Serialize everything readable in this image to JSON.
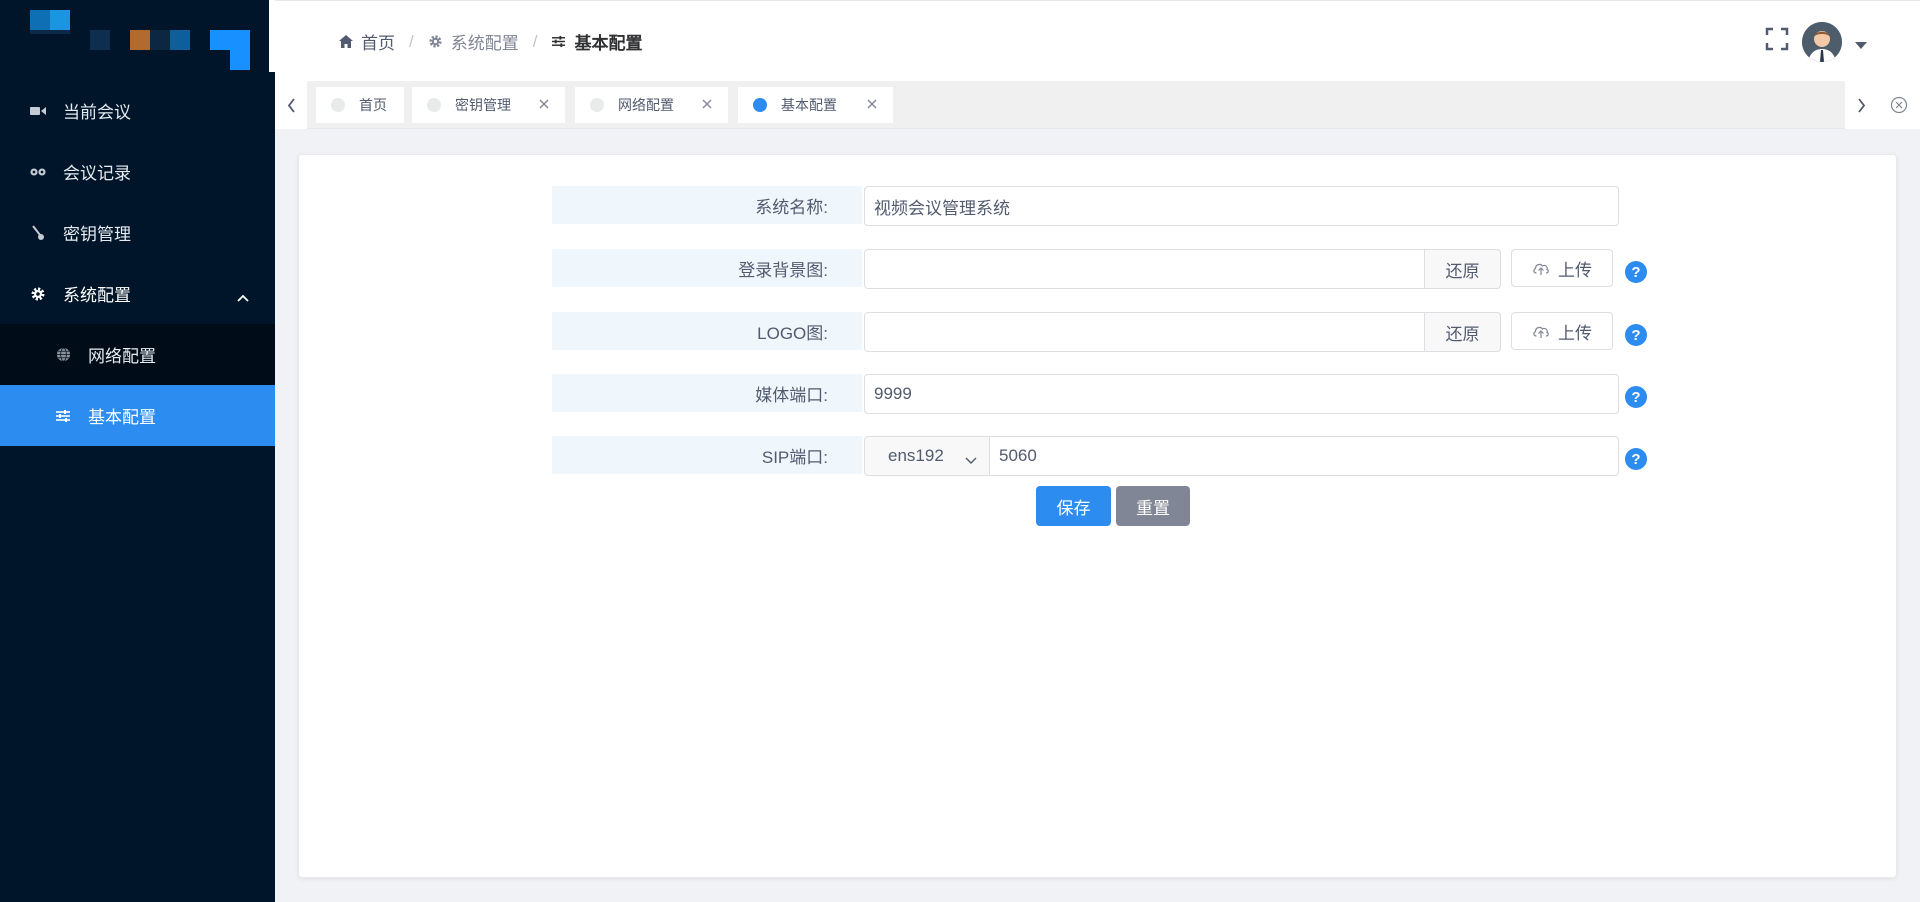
{
  "sidebar": {
    "menu": [
      {
        "label": "当前会议",
        "icon": "video-camera-icon"
      },
      {
        "label": "会议记录",
        "icon": "record-icon"
      },
      {
        "label": "密钥管理",
        "icon": "key-icon"
      },
      {
        "label": "系统配置",
        "icon": "gear-icon"
      }
    ],
    "submenu": [
      {
        "label": "网络配置",
        "icon": "globe-icon"
      },
      {
        "label": "基本配置",
        "icon": "sliders-icon"
      }
    ]
  },
  "breadcrumb": {
    "home": "首页",
    "system": "系统配置",
    "current": "基本配置",
    "separator": "/"
  },
  "tabs": [
    {
      "label": "首页",
      "closable": false,
      "active": false
    },
    {
      "label": "密钥管理",
      "closable": true,
      "active": false
    },
    {
      "label": "网络配置",
      "closable": true,
      "active": false
    },
    {
      "label": "基本配置",
      "closable": true,
      "active": true
    }
  ],
  "form": {
    "system_name": {
      "label": "系统名称:",
      "value": "视频会议管理系统"
    },
    "login_bg": {
      "label": "登录背景图:",
      "value": "",
      "restore": "还原",
      "upload": "上传"
    },
    "logo": {
      "label": "LOGO图:",
      "value": "",
      "restore": "还原",
      "upload": "上传"
    },
    "media_port": {
      "label": "媒体端口:",
      "value": "9999"
    },
    "sip_port": {
      "label": "SIP端口:",
      "interface": "ens192",
      "value": "5060"
    },
    "help": "?"
  },
  "buttons": {
    "save": "保存",
    "reset": "重置"
  },
  "colors": {
    "sidebar_bg": "#001529",
    "submenu_bg": "#000c17",
    "accent": "#2d8cf0",
    "reset_btn": "#808695",
    "label_bg": "#f0f7fc"
  }
}
